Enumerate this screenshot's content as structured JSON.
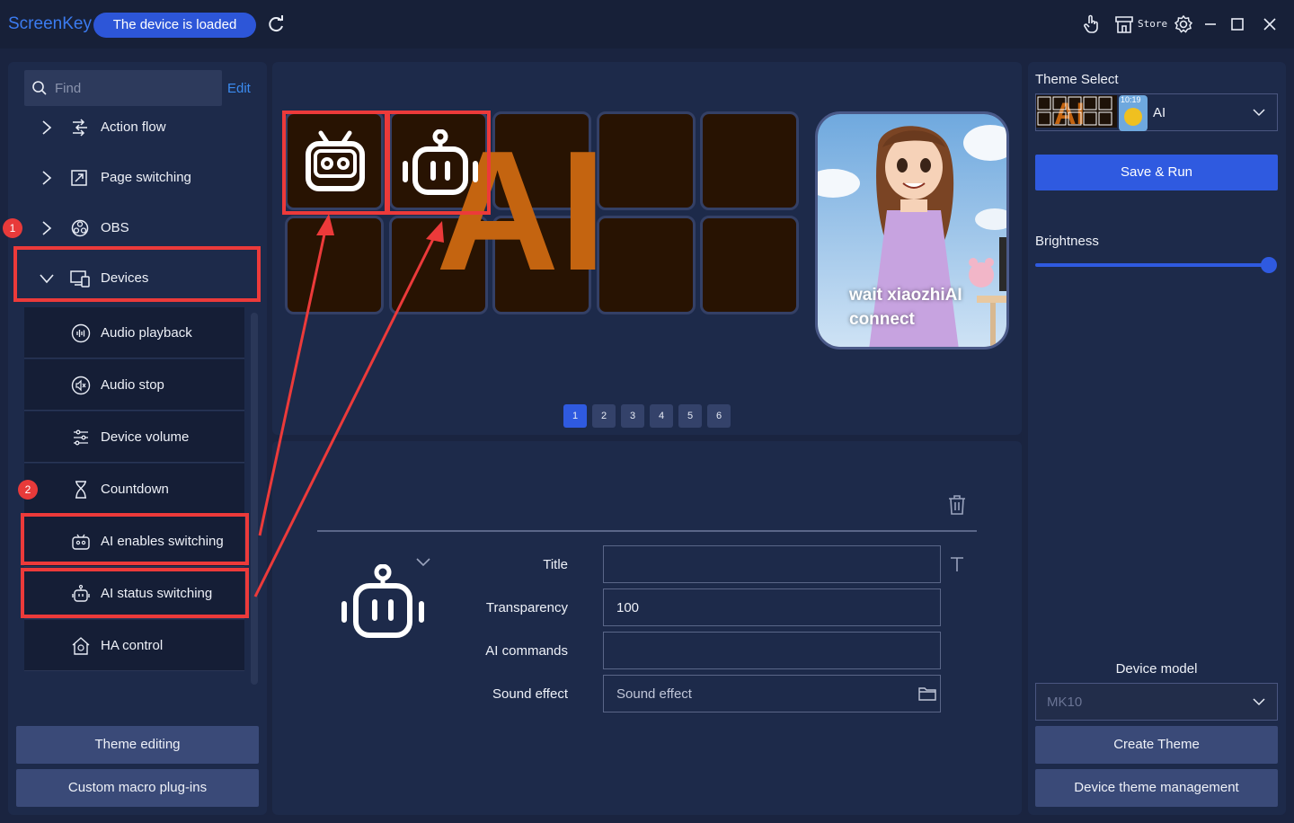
{
  "titlebar": {
    "app_name": "ScreenKey",
    "status": "The device is loaded",
    "store_label": "Store"
  },
  "sidebar": {
    "search_placeholder": "Find",
    "edit_label": "Edit",
    "tree": [
      {
        "label": "Action flow"
      },
      {
        "label": "Page switching"
      },
      {
        "label": "OBS"
      },
      {
        "label": "Devices"
      }
    ],
    "device_items": [
      {
        "label": "Audio playback"
      },
      {
        "label": "Audio stop"
      },
      {
        "label": "Device volume"
      },
      {
        "label": "Countdown"
      },
      {
        "label": "AI enables switching"
      },
      {
        "label": "AI status switching"
      },
      {
        "label": "HA control"
      }
    ],
    "badges": [
      "1",
      "2"
    ],
    "theme_editing_label": "Theme editing",
    "custom_macro_label": "Custom macro plug-ins"
  },
  "preview": {
    "bg_text": "AI",
    "big_key_caption": "wait xiaozhiAI connect",
    "pages": [
      "1",
      "2",
      "3",
      "4",
      "5",
      "6"
    ],
    "active_page": "1"
  },
  "editor": {
    "title_label": "Title",
    "title_value": "",
    "transparency_label": "Transparency",
    "transparency_value": "100",
    "ai_commands_label": "AI commands",
    "ai_commands_value": "",
    "sound_effect_label": "Sound effect",
    "sound_effect_placeholder": "Sound effect"
  },
  "right_panel": {
    "theme_select_label": "Theme Select",
    "theme_value": "AI",
    "theme_thumb_time": "10:19",
    "save_run_label": "Save & Run",
    "brightness_label": "Brightness",
    "brightness_level": 1.0,
    "device_model_label": "Device model",
    "device_model_value": "MK10",
    "create_theme_label": "Create Theme",
    "device_theme_mgmt_label": "Device theme management"
  },
  "colors": {
    "accent": "#2f5ae0",
    "highlight": "#ec3a3a",
    "key_bg": "#281302",
    "ai_orange": "#c46410"
  }
}
